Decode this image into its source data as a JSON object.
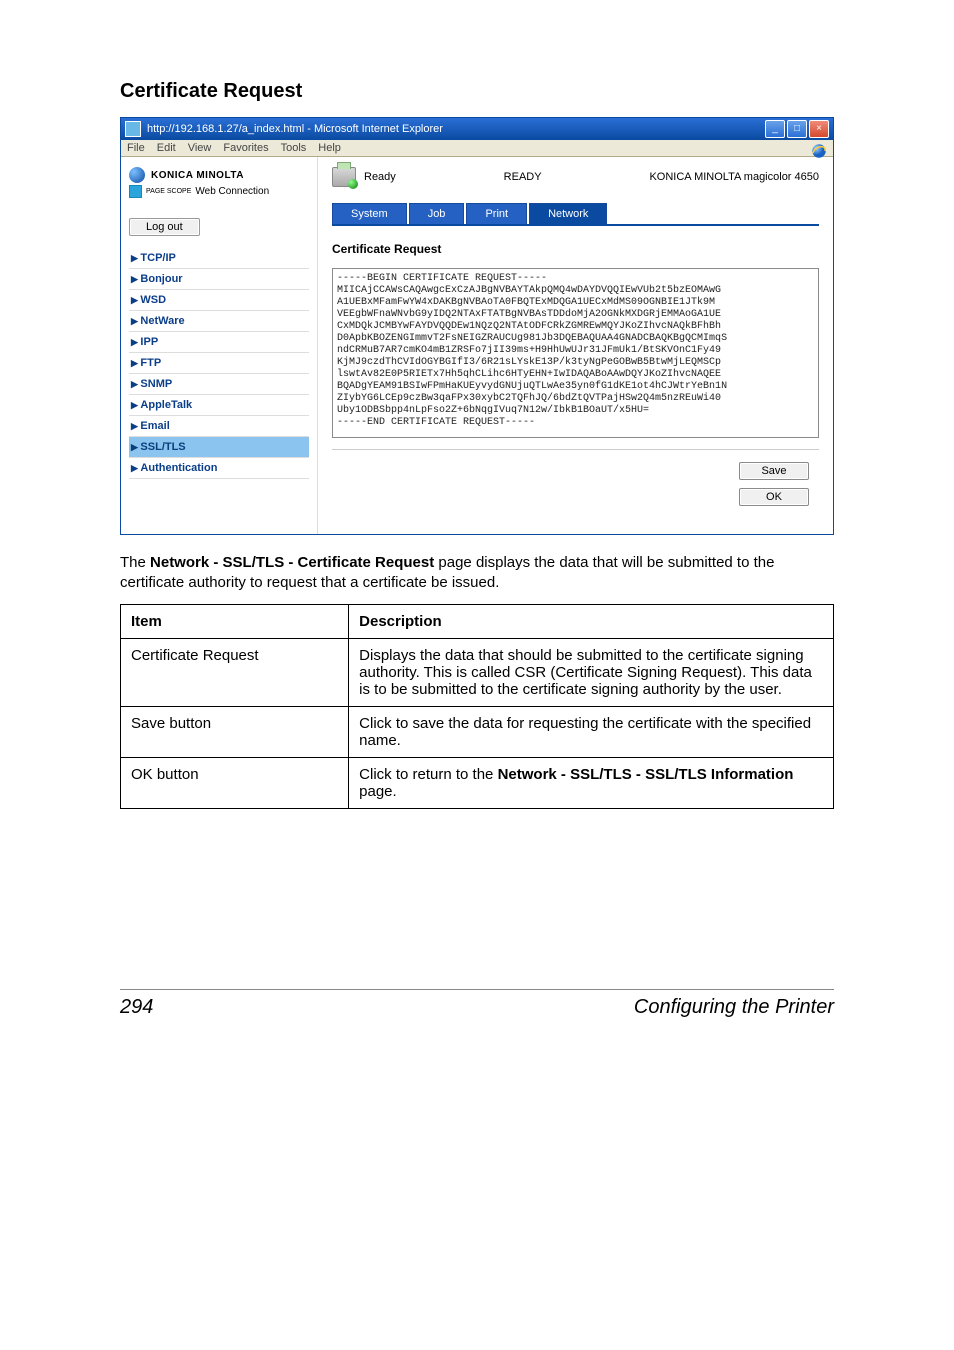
{
  "section_title": "Certificate Request",
  "browser": {
    "title": "http://192.168.1.27/a_index.html - Microsoft Internet Explorer",
    "menus": [
      "File",
      "Edit",
      "View",
      "Favorites",
      "Tools",
      "Help"
    ]
  },
  "brand": {
    "name": "KONICA MINOLTA",
    "sub_prefix": "PAGE SCOPE",
    "sub": "Web Connection"
  },
  "logout_label": "Log out",
  "status": {
    "left": "Ready",
    "center": "READY",
    "right": "KONICA MINOLTA magicolor 4650"
  },
  "tabs": [
    {
      "label": "System",
      "active": false
    },
    {
      "label": "Job",
      "active": false
    },
    {
      "label": "Print",
      "active": false
    },
    {
      "label": "Network",
      "active": true
    }
  ],
  "sidenav": [
    {
      "label": "TCP/IP",
      "active": false
    },
    {
      "label": "Bonjour",
      "active": false
    },
    {
      "label": "WSD",
      "active": false
    },
    {
      "label": "NetWare",
      "active": false
    },
    {
      "label": "IPP",
      "active": false
    },
    {
      "label": "FTP",
      "active": false
    },
    {
      "label": "SNMP",
      "active": false
    },
    {
      "label": "AppleTalk",
      "active": false
    },
    {
      "label": "Email",
      "active": false
    },
    {
      "label": "SSL/TLS",
      "active": true
    },
    {
      "label": "Authentication",
      "active": false
    }
  ],
  "panel_heading": "Certificate Request",
  "cert_text": "-----BEGIN CERTIFICATE REQUEST-----\nMIICAjCCAWsCAQAwgcExCzAJBgNVBAYTAkpQMQ4wDAYDVQQIEwVUb2t5bzEOMAwG\nA1UEBxMFamFwYW4xDAKBgNVBAoTA0FBQTExMDQGA1UECxMdMS09OGNBIE1JTk9M\nVEEgbWFnaWNvbG9yIDQ2NTAxFTATBgNVBAsTDDdoMjA2OGNkMXDGRjEMMAoGA1UE\nCxMDQkJCMBYwFAYDVQQDEw1NQzQ2NTAtODFCRkZGMREwMQYJKoZIhvcNAQkBFhBh\nD0ApbKBOZENGImmvT2FsNEIGZRAUCUg981Jb3DQEBAQUAA4GNADCBAQKBgQCMImqS\nndCRMuB7AR7cmKO4mB1ZRSFo7jII39ms+H9HhUwUJr31JFmUk1/BtSKVOnC1Fy49\nKjMJ9czdThCVIdOGYBGIfI3/6R21sLYskE13P/k3tyNgPeGOBwB5BtwMjLEQMSCp\nlswtAv82E0P5RIETx7Hh5qhCLihc6HTyEHN+IwIDAQABoAAwDQYJKoZIhvcNAQEE\nBQADgYEAM91BSIwFPmHaKUEyvydGNUjuQTLwAe35yn0fG1dKE1ot4hCJWtrYeBn1N\nZIybYG6LCEp9czBw3qaFPx30xybC2TQFhJQ/6bdZtQVTPajHSw2Q4m5nzREuWi40\nUby1ODBSbpp4nLpFso2Z+6bNqgIVuq7N12w/IbkB1BOaUT/x5HU=\n-----END CERTIFICATE REQUEST-----",
  "buttons": {
    "save": "Save",
    "ok": "OK"
  },
  "body_text": {
    "p1_a": "The ",
    "p1_b": "Network - SSL/TLS - Certificate Request",
    "p1_c": " page displays the data that will be submitted to the certificate authority to request that a certificate be issued."
  },
  "desc_table": {
    "headers": [
      "Item",
      "Description"
    ],
    "rows": [
      {
        "item": "Certificate Request",
        "desc": "Displays the data that should be submitted to the certificate signing authority. This is called CSR (Certificate Signing Request). This data is to be submitted to the certificate signing authority by the user."
      },
      {
        "item": "Save button",
        "desc": "Click to save the data for requesting the certificate with the specified name."
      },
      {
        "item": "OK button",
        "desc_pre": "Click to return to the ",
        "desc_b1": "Network - SSL/TLS - SSL/TLS Information",
        "desc_post": " page."
      }
    ]
  },
  "footer": {
    "page": "294",
    "text": "Configuring the Printer"
  }
}
